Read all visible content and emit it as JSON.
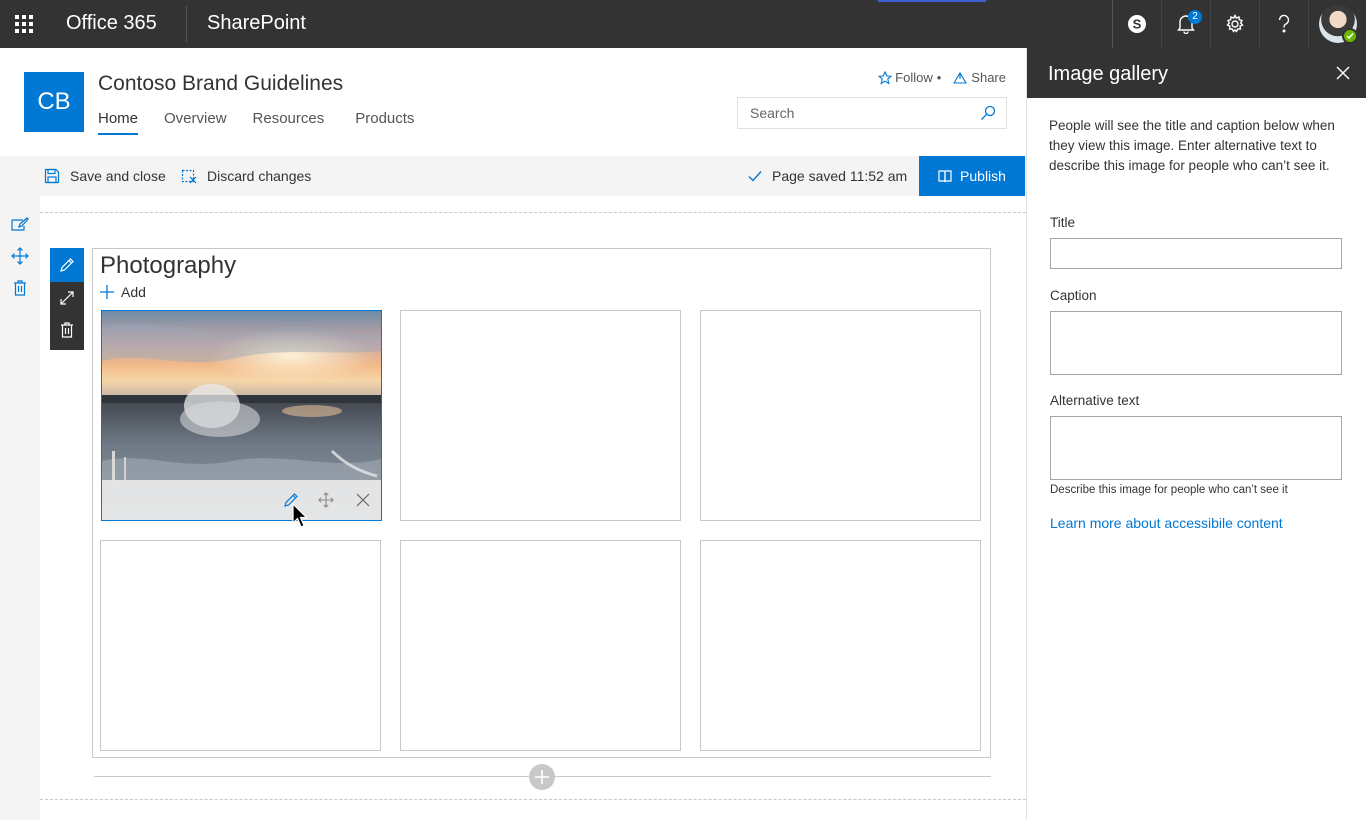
{
  "suite": {
    "brand": "Office 365",
    "app": "SharePoint",
    "notifications_count": "2",
    "icons": [
      "waffle-icon",
      "skype-icon",
      "bell-icon",
      "gear-icon",
      "help-icon"
    ]
  },
  "site": {
    "logo_text": "CB",
    "title": "Contoso Brand Guidelines",
    "nav": [
      "Home",
      "Overview",
      "Resources",
      "Products"
    ],
    "follow": "Follow",
    "follow_sep": "•",
    "share": "Share",
    "search_placeholder": "Search"
  },
  "commandbar": {
    "save_close": "Save and close",
    "discard": "Discard changes",
    "saved_status": "Page saved 11:52 am",
    "publish": "Publish"
  },
  "webpart": {
    "title": "Photography",
    "add": "Add"
  },
  "panel": {
    "title": "Image gallery",
    "description": "People will see the title and caption below when they view this image. Enter alternative text to describe this image for people who can’t see it.",
    "title_label": "Title",
    "title_value": "",
    "caption_label": "Caption",
    "caption_value": "",
    "alt_label": "Alternative text",
    "alt_value": "",
    "alt_helper": "Describe this image for people who can’t see it",
    "learn_more": "Learn more about accessibile content"
  },
  "colors": {
    "suite_bar": "#333333",
    "accent": "#0078d4",
    "rail": "#f4f4f4"
  }
}
